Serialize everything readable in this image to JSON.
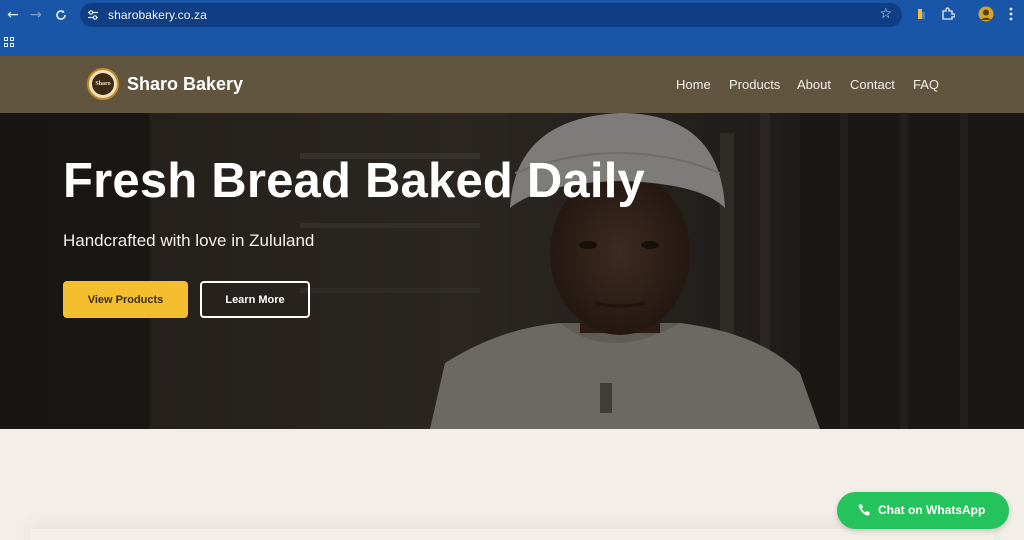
{
  "browser": {
    "url": "sharobakery.co.za",
    "icons": {
      "back": "arrow-left-icon",
      "forward": "arrow-right-icon",
      "reload": "reload-icon",
      "site_info": "tune-icon",
      "bookmark": "star-icon",
      "extension": "extension-puzzle-icon",
      "profile": "avatar-icon",
      "menu": "kebab-menu-icon",
      "apps": "apps-grid-icon"
    }
  },
  "header": {
    "brand": "Sharo Bakery",
    "logo_text": "Sharo",
    "nav": [
      {
        "label": "Home"
      },
      {
        "label": "Products"
      },
      {
        "label": "About"
      },
      {
        "label": "Contact"
      },
      {
        "label": "FAQ"
      }
    ]
  },
  "hero": {
    "title": "Fresh Bread Baked Daily",
    "subtitle": "Handcrafted with love in Zululand",
    "primary_cta": "View Products",
    "secondary_cta": "Learn More"
  },
  "whatsapp": {
    "label": "Chat on WhatsApp",
    "icon": "phone-icon"
  },
  "colors": {
    "browser_chrome": "#1a56a8",
    "omnibox": "#0f3e85",
    "header": "#62553f",
    "accent": "#f5be2e",
    "page_bg": "#f3efe8",
    "whatsapp": "#25c35c"
  }
}
